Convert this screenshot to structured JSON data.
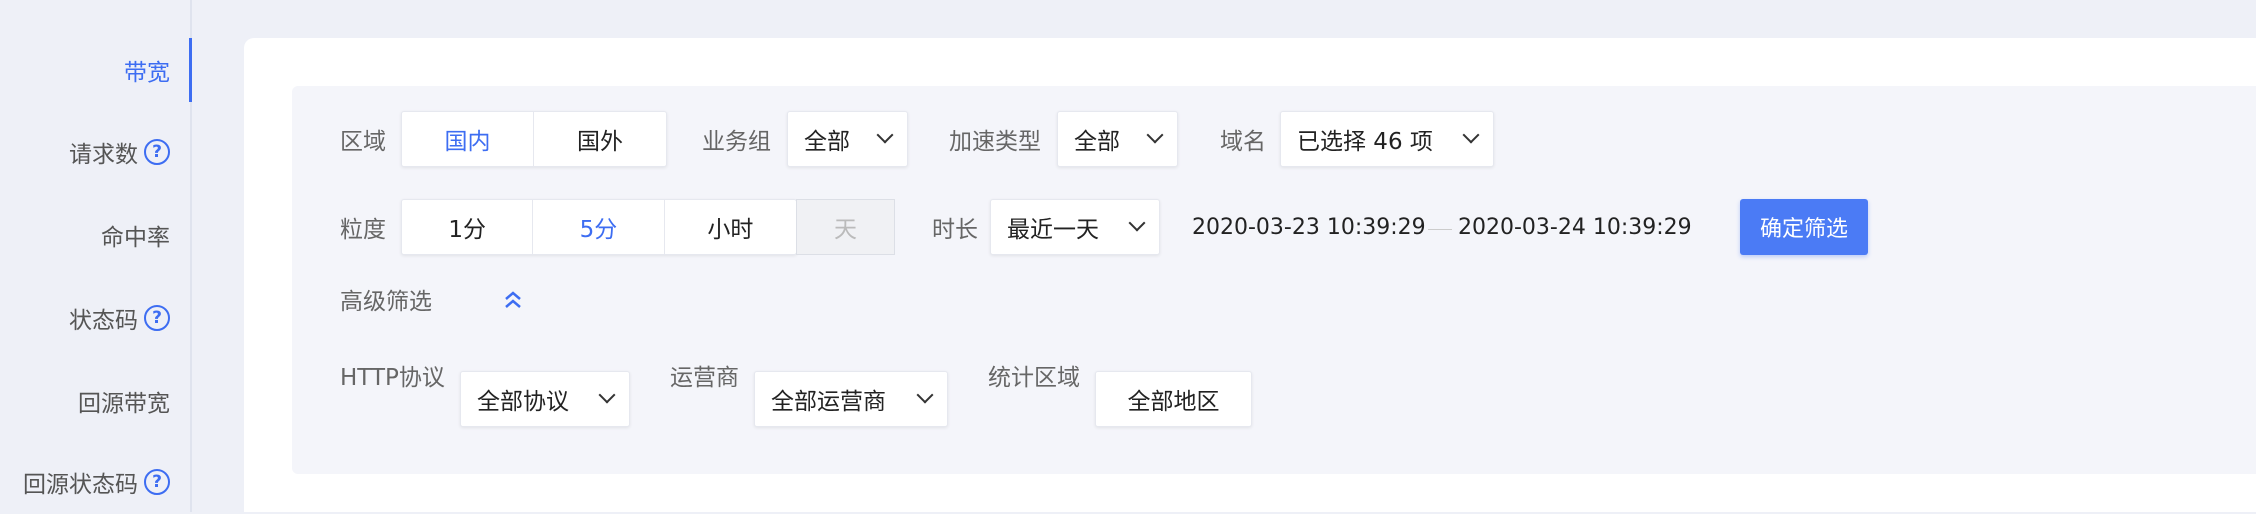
{
  "sidebar": {
    "items": [
      {
        "label": "带宽",
        "help": false,
        "active": true
      },
      {
        "label": "请求数",
        "help": true,
        "active": false
      },
      {
        "label": "命中率",
        "help": false,
        "active": false
      },
      {
        "label": "状态码",
        "help": true,
        "active": false
      },
      {
        "label": "回源带宽",
        "help": false,
        "active": false
      },
      {
        "label": "回源状态码",
        "help": true,
        "active": false
      }
    ],
    "help_glyph": "?"
  },
  "filters": {
    "region": {
      "label": "区域",
      "options": [
        "国内",
        "国外"
      ],
      "selected": "国内"
    },
    "business_group": {
      "label": "业务组",
      "value": "全部"
    },
    "accel_type": {
      "label": "加速类型",
      "value": "全部"
    },
    "domain": {
      "label": "域名",
      "value": "已选择 46 项"
    },
    "granularity": {
      "label": "粒度",
      "options": [
        "1分",
        "5分",
        "小时",
        "天"
      ],
      "selected": "5分",
      "disabled": "天"
    },
    "duration": {
      "label": "时长",
      "value": "最近一天"
    },
    "date_start": "2020-03-23 10:39:29",
    "date_end": "2020-03-24 10:39:29",
    "confirm_label": "确定筛选",
    "advanced_label": "高级筛选",
    "http_protocol": {
      "label": "HTTP协议",
      "value": "全部协议"
    },
    "isp": {
      "label": "运营商",
      "value": "全部运营商"
    },
    "stat_region": {
      "label": "统计区域",
      "value": "全部地区"
    }
  },
  "colors": {
    "accent": "#3d6df2",
    "primary_button": "#4b7bf5"
  }
}
